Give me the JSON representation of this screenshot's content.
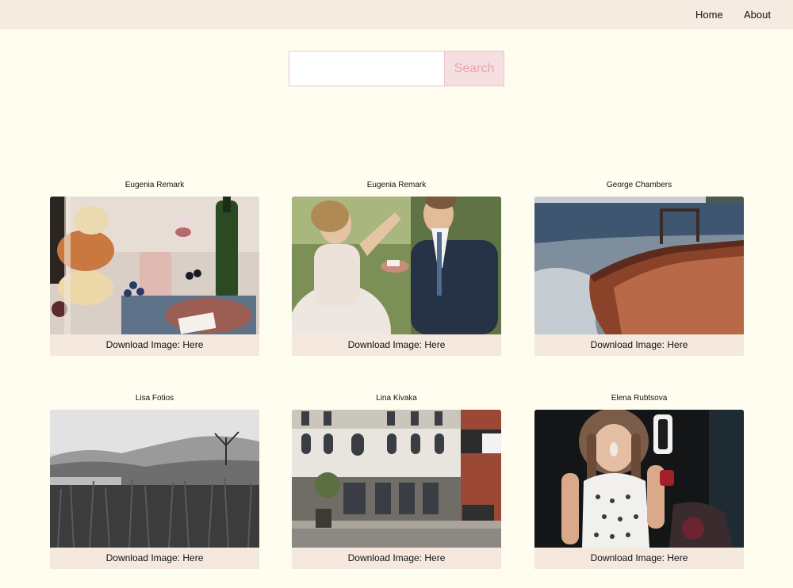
{
  "nav": {
    "home_label": "Home",
    "about_label": "About"
  },
  "search": {
    "value": "",
    "placeholder": "",
    "button_label": "Search"
  },
  "gallery": {
    "download_prefix": "Download Image: ",
    "download_link_label": "Here",
    "items": [
      {
        "author": "Eugenia Remark",
        "image_icon": "wedding-table-photo"
      },
      {
        "author": "Eugenia Remark",
        "image_icon": "wedding-couple-photo"
      },
      {
        "author": "George Chambers",
        "image_icon": "seaside-cliff-photo"
      },
      {
        "author": "Lisa Fotios",
        "image_icon": "misty-field-photo"
      },
      {
        "author": "Lina Kivaka",
        "image_icon": "city-building-photo"
      },
      {
        "author": "Elena Rubtsova",
        "image_icon": "portrait-night-photo"
      }
    ]
  },
  "colors": {
    "page_background": "#fffdf0",
    "header_background": "#f6ebe1",
    "search_button_background": "#f6dfe1",
    "search_button_text": "#e8a3ab",
    "caption_background": "#f5e9df"
  }
}
